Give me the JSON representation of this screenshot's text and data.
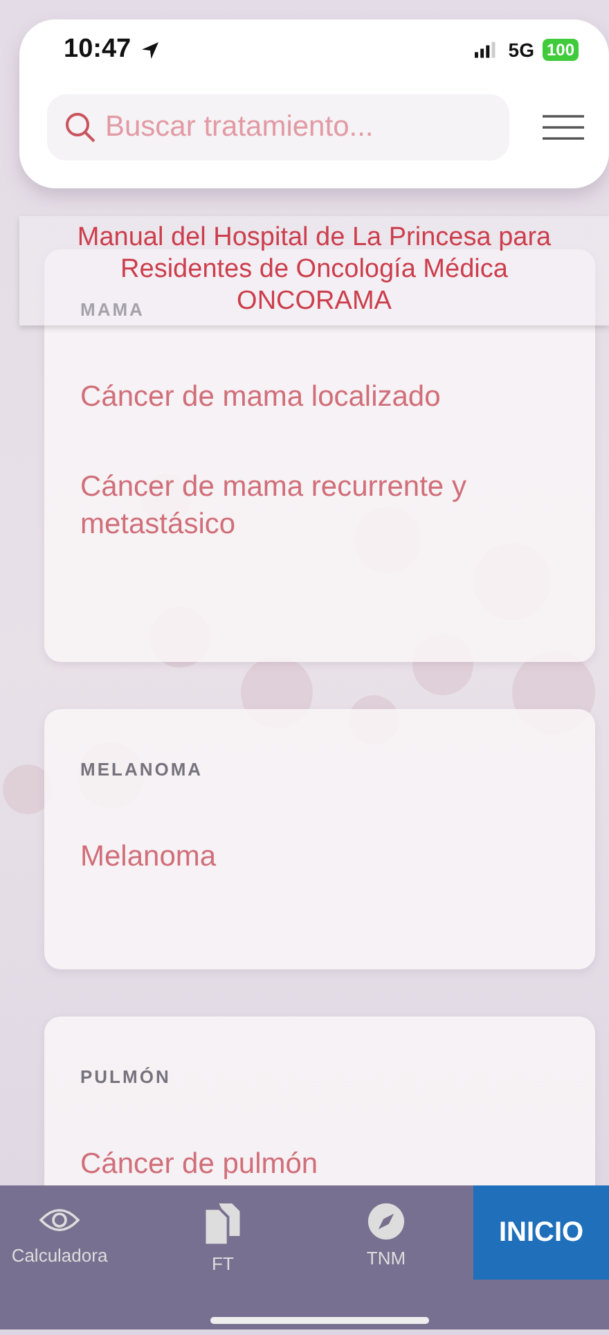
{
  "status_bar": {
    "time": "10:47",
    "network": "5G",
    "battery": "100"
  },
  "search": {
    "placeholder": "Buscar tratamiento..."
  },
  "banner": {
    "lines": [
      "Manual del Hospital de La Princesa para",
      "Residentes de Oncología Médica",
      "ONCORAMA"
    ]
  },
  "sections": [
    {
      "title": "MAMA",
      "items": [
        "Cáncer de mama localizado",
        "Cáncer de mama recurrente y metastásico"
      ]
    },
    {
      "title": "MELANOMA",
      "items": [
        "Melanoma"
      ]
    },
    {
      "title": "PULMÓN",
      "items": [
        "Cáncer de pulmón"
      ]
    }
  ],
  "tab_bar": {
    "tabs": [
      {
        "kind": "eye",
        "label": "Calculadora",
        "selected": false
      },
      {
        "kind": "documents",
        "label": "FT",
        "selected": false
      },
      {
        "kind": "compass",
        "label": "TNM",
        "selected": false
      },
      {
        "kind": "text",
        "label": "INICIO",
        "selected": true
      }
    ]
  }
}
